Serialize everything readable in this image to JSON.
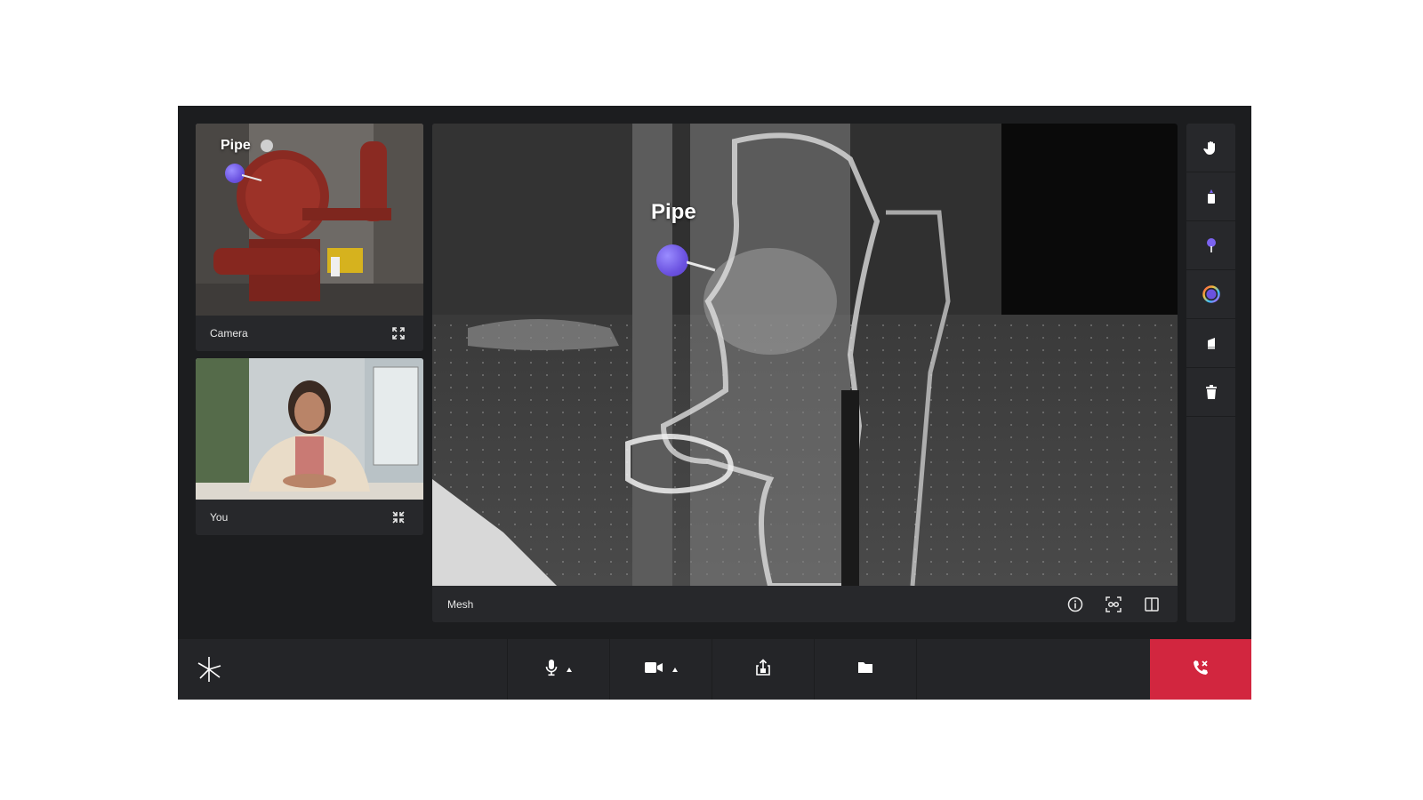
{
  "camera_tile": {
    "label": "Camera",
    "pin_label": "Pipe",
    "action_icon": "expand-icon"
  },
  "you_tile": {
    "label": "You",
    "action_icon": "collapse-icon"
  },
  "mesh_view": {
    "label": "Mesh",
    "pin_label": "Pipe",
    "actions": [
      "info-icon",
      "face-scan-icon",
      "split-view-icon"
    ]
  },
  "tool_rail": {
    "tools": [
      "hand-icon",
      "marker-icon",
      "pin-icon",
      "color-picker-icon",
      "eraser-icon",
      "trash-icon"
    ]
  },
  "controls": {
    "logo": "asterisk-logo-icon",
    "items": [
      "microphone-icon",
      "video-camera-icon",
      "share-icon",
      "folder-icon"
    ],
    "end_call": "end-call-icon"
  },
  "colors": {
    "accent_pin": "#6b52e0",
    "end_call": "#d2263f",
    "background": "#1c1d1f",
    "tile": "#27282b"
  }
}
